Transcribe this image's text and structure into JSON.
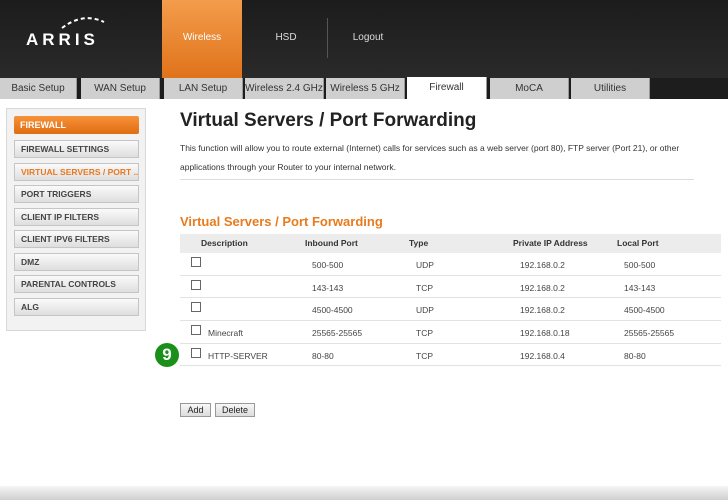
{
  "brand": {
    "name": "ARRIS"
  },
  "topnav": {
    "items": [
      {
        "label": "Wireless"
      },
      {
        "label": "HSD"
      },
      {
        "label": "Logout"
      }
    ]
  },
  "tabs": [
    {
      "label": "Basic Setup"
    },
    {
      "label": "WAN Setup"
    },
    {
      "label": "LAN Setup"
    },
    {
      "label": "Wireless 2.4 GHz"
    },
    {
      "label": "Wireless 5 GHz"
    },
    {
      "label": "Firewall"
    },
    {
      "label": "MoCA"
    },
    {
      "label": "Utilities"
    }
  ],
  "sidebar": {
    "header": "FIREWALL",
    "items": [
      {
        "label": "FIREWALL SETTINGS"
      },
      {
        "label": "VIRTUAL SERVERS / PORT ..."
      },
      {
        "label": "PORT TRIGGERS"
      },
      {
        "label": "CLIENT IP FILTERS"
      },
      {
        "label": "CLIENT IPV6 FILTERS"
      },
      {
        "label": "DMZ"
      },
      {
        "label": "PARENTAL CONTROLS"
      },
      {
        "label": "ALG"
      }
    ]
  },
  "main": {
    "title": "Virtual Servers / Port Forwarding",
    "intro": "This function will allow you to route external (Internet) calls for services such as a web server (port 80), FTP server (Port 21), or other applications through your Router to your internal network.",
    "section_title": "Virtual Servers / Port Forwarding",
    "table": {
      "headers": [
        "Description",
        "Inbound Port",
        "Type",
        "Private IP Address",
        "Local Port"
      ],
      "rows": [
        {
          "description": "",
          "inbound": "500-500",
          "type": "UDP",
          "ip": "192.168.0.2",
          "local": "500-500"
        },
        {
          "description": "",
          "inbound": "143-143",
          "type": "TCP",
          "ip": "192.168.0.2",
          "local": "143-143"
        },
        {
          "description": "",
          "inbound": "4500-4500",
          "type": "UDP",
          "ip": "192.168.0.2",
          "local": "4500-4500"
        },
        {
          "description": "Minecraft",
          "inbound": "25565-25565",
          "type": "TCP",
          "ip": "192.168.0.18",
          "local": "25565-25565"
        },
        {
          "description": "HTTP-SERVER",
          "inbound": "80-80",
          "type": "TCP",
          "ip": "192.168.0.4",
          "local": "80-80"
        }
      ]
    },
    "step_badge": "9",
    "buttons": {
      "add": "Add",
      "delete": "Delete"
    }
  },
  "colors": {
    "accent": "#e87b1e",
    "badge": "#1a8f1a"
  }
}
